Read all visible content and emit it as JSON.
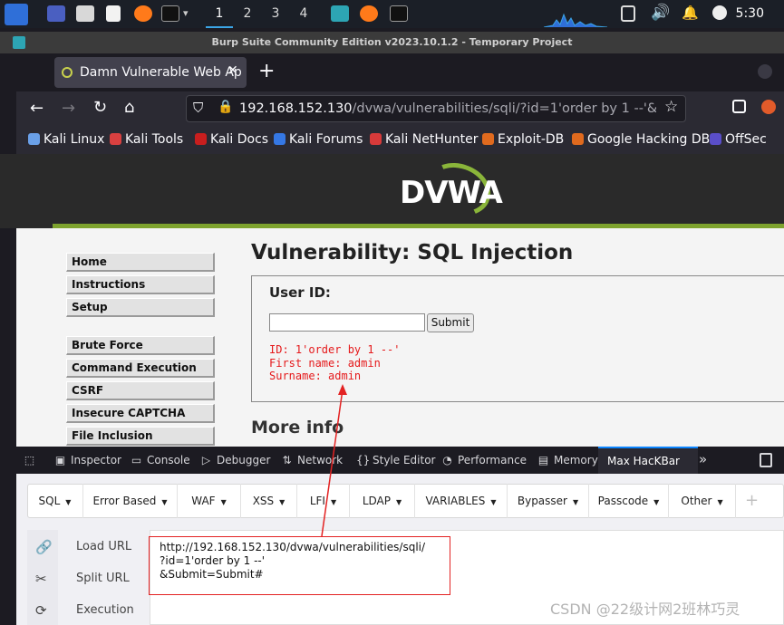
{
  "taskbar": {
    "workspaces": [
      "1",
      "2",
      "3",
      "4"
    ],
    "clock": "5:30"
  },
  "burp": {
    "title": "Burp Suite Community Edition v2023.10.1.2 - Temporary Project"
  },
  "browser": {
    "tab_title": "Damn Vulnerable Web Ap",
    "new_tab": "+",
    "url_host": "192.168.152.130",
    "url_path": "/dvwa/vulnerabilities/sqli/?id=1'order by 1 --'&Submit=",
    "bookmarks": [
      "Kali Linux",
      "Kali Tools",
      "Kali Docs",
      "Kali Forums",
      "Kali NetHunter",
      "Exploit-DB",
      "Google Hacking DB",
      "OffSec"
    ]
  },
  "dvwa": {
    "logo": "DVWA",
    "menu": [
      "Home",
      "Instructions",
      "Setup",
      "Brute Force",
      "Command Execution",
      "CSRF",
      "Insecure CAPTCHA",
      "File Inclusion"
    ],
    "heading": "Vulnerability: SQL Injection",
    "user_id_label": "User ID:",
    "submit_label": "Submit",
    "result": [
      "ID: 1'order by 1 --'",
      "First name: admin",
      "Surname: admin"
    ],
    "more_info": "More info"
  },
  "devtools": {
    "tabs": [
      "Inspector",
      "Console",
      "Debugger",
      "Network",
      "Style Editor",
      "Performance",
      "Memory",
      "Max HacKBar"
    ],
    "active_tab": "Max HacKBar"
  },
  "hackbar": {
    "menus": [
      "SQL",
      "Error Based",
      "WAF",
      "XSS",
      "LFI",
      "LDAP",
      "VARIABLES",
      "Bypasser",
      "Passcode",
      "Other"
    ],
    "actions": [
      "Load URL",
      "Split URL",
      "Execution"
    ],
    "url_lines": [
      "http://192.168.152.130/dvwa/vulnerabilities/sqli/",
      "?id=1'order by 1 --'",
      "&Submit=Submit#"
    ]
  },
  "watermark": "CSDN @22级计网2班林巧灵",
  "colors": {
    "result_red": "#e5191b",
    "annotation_red": "#e32222",
    "dvwa_green": "#7ea32e",
    "devtools_accent": "#0a84ff"
  }
}
